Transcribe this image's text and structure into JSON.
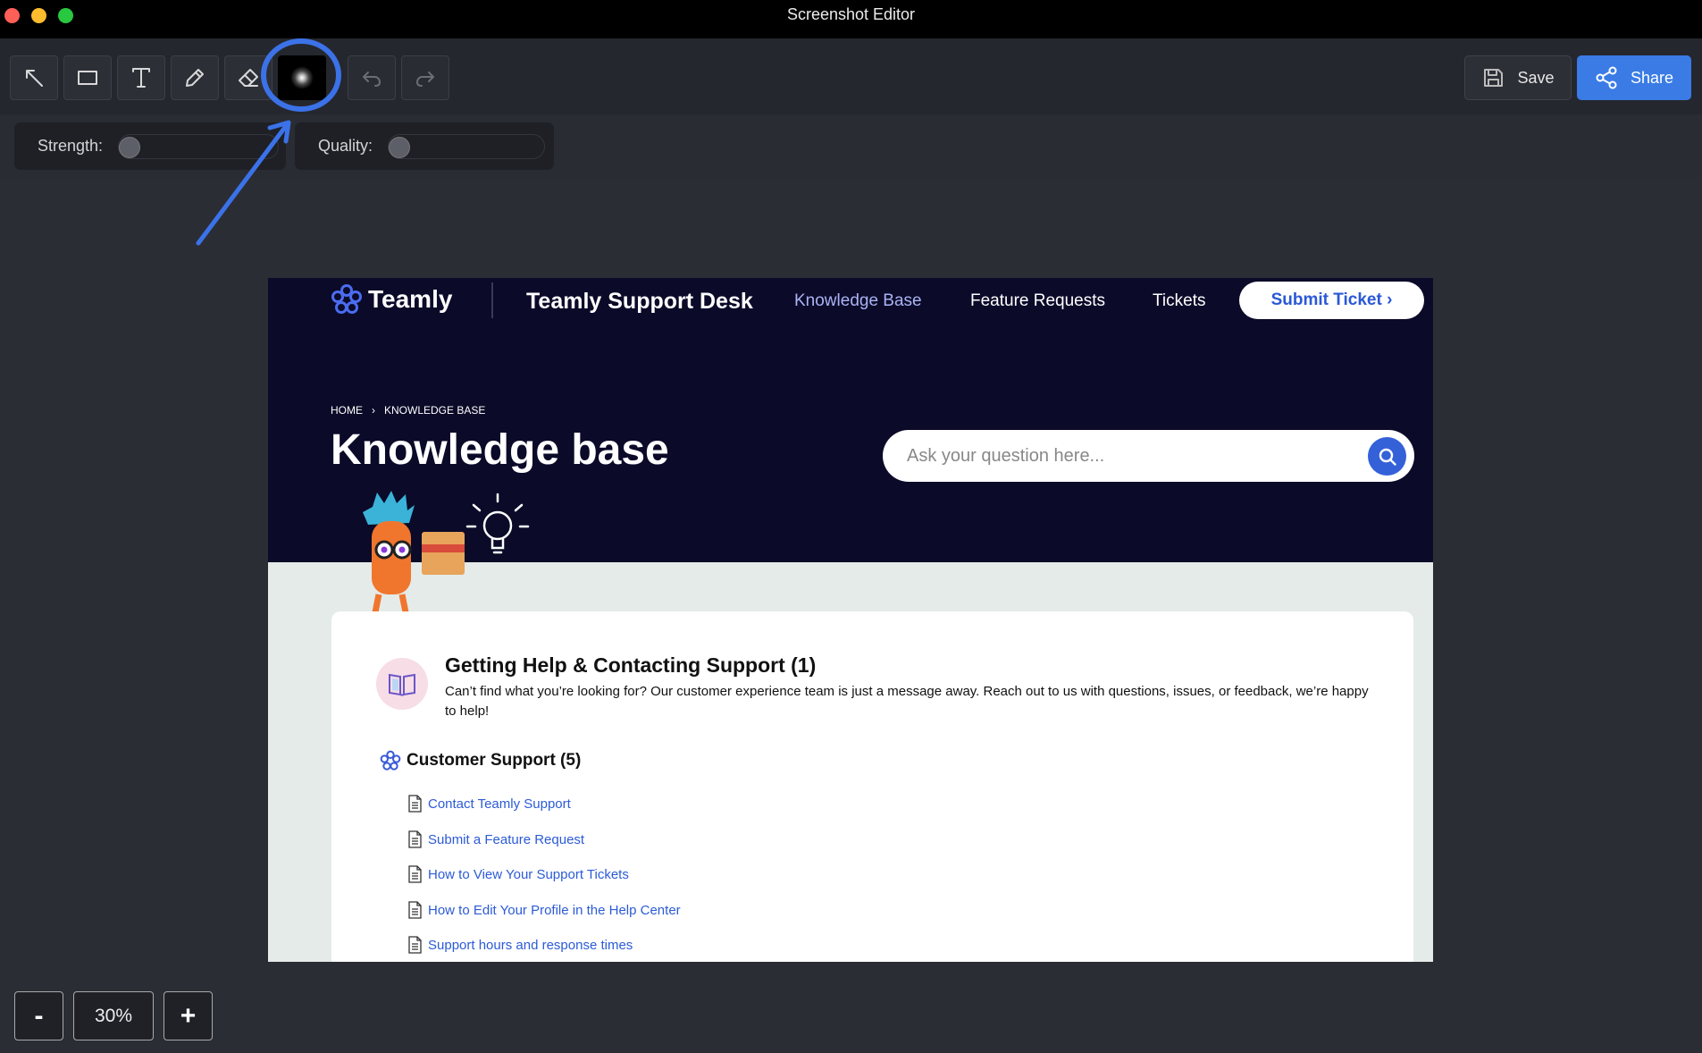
{
  "window": {
    "title": "Screenshot Editor"
  },
  "toolbar": {
    "tools": [
      {
        "name": "arrow-tool",
        "icon": "arrow-up-left-icon"
      },
      {
        "name": "rectangle-tool",
        "icon": "rectangle-icon"
      },
      {
        "name": "text-tool",
        "icon": "text-t-icon"
      },
      {
        "name": "pen-tool",
        "icon": "pencil-icon"
      },
      {
        "name": "eraser-tool",
        "icon": "eraser-icon"
      },
      {
        "name": "blur-tool",
        "icon": "blur-icon",
        "selected": true
      },
      {
        "name": "undo-button",
        "icon": "undo-icon",
        "disabled": true
      },
      {
        "name": "redo-button",
        "icon": "redo-icon",
        "disabled": true
      }
    ],
    "save_label": "Save",
    "share_label": "Share"
  },
  "options": {
    "strength_label": "Strength:",
    "strength_value": 0,
    "quality_label": "Quality:",
    "quality_value": 0
  },
  "page": {
    "logo_text": "Teamly",
    "desk_title": "Teamly Support Desk",
    "nav": {
      "knowledge_base": "Knowledge Base",
      "feature_requests": "Feature Requests",
      "tickets": "Tickets",
      "submit_ticket": "Submit Ticket ›"
    },
    "breadcrumb": {
      "home": "HOME",
      "separator": "›",
      "current": "KNOWLEDGE BASE"
    },
    "heading": "Knowledge base",
    "search_placeholder": "Ask your question here...",
    "category": {
      "title": "Getting Help & Contacting Support (1)",
      "description": "Can’t find what you’re looking for? Our customer experience team is just a message away. Reach out to us with questions, issues, or feedback, we’re happy to help!"
    },
    "subcategory": {
      "title": "Customer Support (5)",
      "articles": [
        "Contact Teamly Support",
        "Submit a Feature Request",
        "How to View Your Support Tickets",
        "How to Edit Your Profile in the Help Center",
        "Support hours and response times"
      ]
    }
  },
  "zoom": {
    "minus_label": "-",
    "value": "30%",
    "plus_label": "+"
  },
  "colors": {
    "accent": "#3a7be6",
    "hero_bg": "#0b0a29",
    "link": "#2c5bd6",
    "annotation": "#3b72e8"
  }
}
